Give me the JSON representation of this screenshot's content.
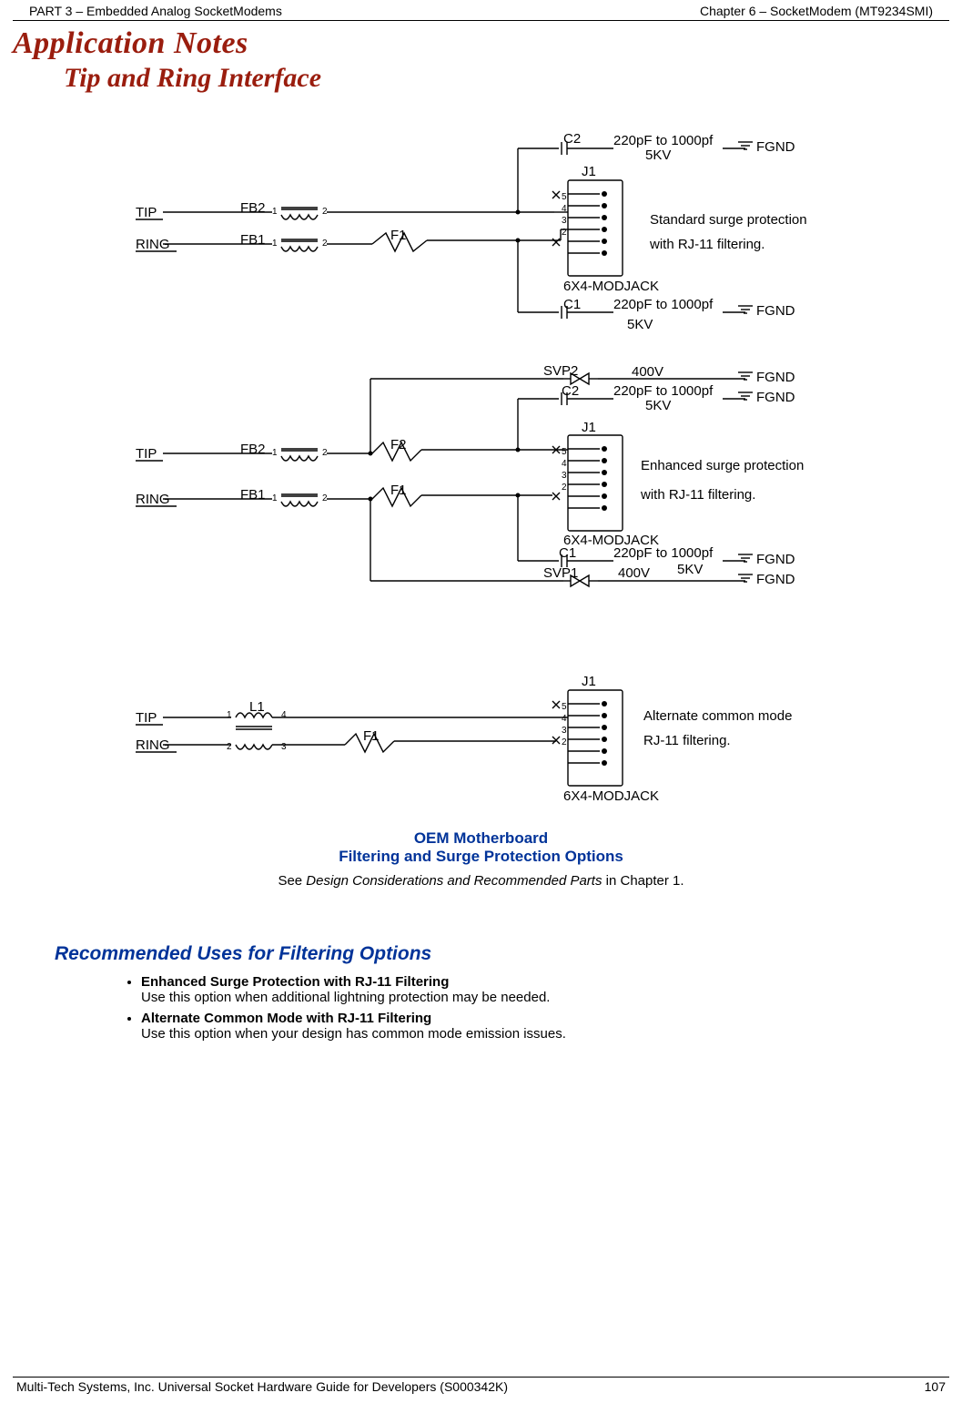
{
  "header": {
    "left": "PART 3 – Embedded Analog SocketModems",
    "right": "Chapter 6 – SocketModem (MT9234SMI)"
  },
  "title": {
    "main": "Application Notes",
    "sub": "Tip and Ring Interface"
  },
  "labels": {
    "tip": "TIP",
    "ring": "RING",
    "fb1": "FB1",
    "fb2": "FB2",
    "f1": "F1",
    "f2": "F2",
    "l1": "L1",
    "c1": "C1",
    "c2": "C2",
    "j1": "J1",
    "jack": "6X4-MODJACK",
    "svp1": "SVP1",
    "svp2": "SVP2",
    "cap": "220pF to 1000pf",
    "kv": "5KV",
    "v400": "400V",
    "fgnd": "FGND",
    "p1": "1",
    "p2": "2",
    "p3": "3",
    "p4": "4",
    "p5": "5",
    "std1": "Standard surge protection",
    "std2": "with RJ-11 filtering.",
    "enh1": "Enhanced surge protection",
    "enh2": "with RJ-11 filtering.",
    "alt1": "Alternate common mode",
    "alt2": "RJ-11 filtering."
  },
  "caption": {
    "l1": "OEM Motherboard",
    "l2": "Filtering and Surge Protection Options",
    "note_pre": "See ",
    "note_it": "Design Considerations and Recommended Parts",
    "note_post": " in Chapter 1."
  },
  "rec": {
    "heading": "Recommended Uses for Filtering Options",
    "items": [
      {
        "title": "Enhanced Surge Protection with RJ-11 Filtering",
        "body": "Use this option when additional lightning protection may be needed."
      },
      {
        "title": "Alternate Common Mode with RJ-11 Filtering",
        "body": "Use this option when your design has common mode emission issues."
      }
    ]
  },
  "footer": {
    "left": "Multi-Tech Systems, Inc. Universal Socket Hardware Guide for Developers (S000342K)",
    "right": "107"
  }
}
